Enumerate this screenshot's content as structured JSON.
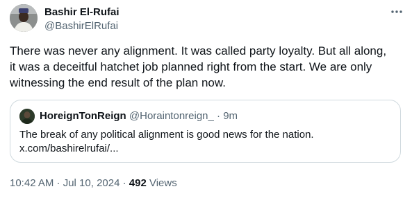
{
  "author": {
    "name": "Bashir El-Rufai",
    "handle": "@BashirElRufai"
  },
  "menu": {
    "more_icon": "more-horizontal-icon"
  },
  "tweet": {
    "lines": [
      "There was never any alignment. It was called party loyalty. But all along,",
      "it was a deceitful hatchet job planned right from the start. We are only",
      "witnessing the end result of the plan now."
    ]
  },
  "quote": {
    "name": "HoreignTonReign",
    "handle": "@Horaintonreign_",
    "separator": "·",
    "time": "9m",
    "lines": [
      "The break of any political alignment is good news for the nation.",
      "x.com/bashirelrufai/..."
    ]
  },
  "meta": {
    "timestamp": "10:42 AM · Jul 10, 2024",
    "separator": "·",
    "views_count": "492",
    "views_label": "Views"
  }
}
